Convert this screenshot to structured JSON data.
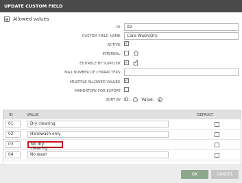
{
  "window": {
    "title": "UPDATE CUSTOM FIELD"
  },
  "section": {
    "title": "Allowed values"
  },
  "form": {
    "id": {
      "label": "ID:",
      "value": "02"
    },
    "name": {
      "label": "CUSTOM FIELD NAME:",
      "value": "Care Wash/Dry"
    },
    "active": {
      "label": "ACTIVE:",
      "checked": true,
      "mark": "✓"
    },
    "internal": {
      "label": "INTERNAL:",
      "checked": false,
      "icon": "home-icon"
    },
    "editable": {
      "label": "EDITABLE BY SUPPLIER:",
      "checked": true,
      "mark": "✓",
      "icon": "factory-icon"
    },
    "max_chars": {
      "label": "MAX NUMBER OF CHARACTERS:",
      "value": ""
    },
    "multiple": {
      "label": "MULTIPLE ALLOWED VALUES:",
      "checked": true,
      "mark": "✓"
    },
    "mandatory": {
      "label": "MANDATORY FOR EXPORT:",
      "checked": false
    },
    "sort": {
      "label": "SORT BY:",
      "option_id": "ID:",
      "option_value": "Value:",
      "selected": "value"
    }
  },
  "table": {
    "columns": {
      "id": "ID",
      "value": "VALUE",
      "default": "DEFAULT"
    },
    "rows": [
      {
        "id": "01",
        "value": "Dry cleaning",
        "default": false
      },
      {
        "id": "02",
        "value": "Handwash only",
        "default": false
      },
      {
        "id": "03",
        "value": "No dry cleaning",
        "default": false,
        "highlighted": true
      },
      {
        "id": "04",
        "value": "No wash",
        "default": false
      }
    ]
  },
  "footer": {
    "ok": "OK",
    "cancel": "CANCEL"
  },
  "colors": {
    "titlebar": "#4a4a4a",
    "ok": "#8da88c",
    "cancel": "#c5c5c5",
    "highlight": "#c0141b"
  }
}
